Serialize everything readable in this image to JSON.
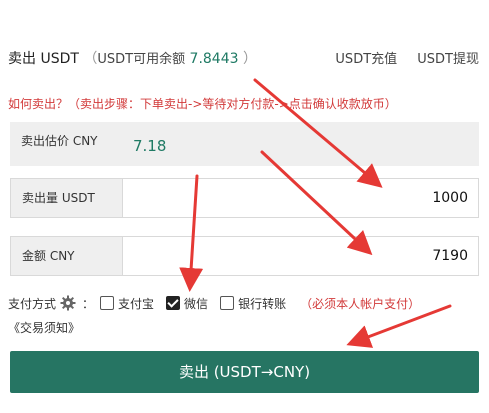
{
  "header": {
    "title": "卖出 USDT",
    "balance_label_open": "（",
    "balance_label": "USDT可用余额",
    "balance_value": "7.8443",
    "balance_label_close": "）",
    "links": [
      "USDT充值",
      "USDT提现"
    ]
  },
  "howto": "如何卖出？（卖出步骤：下单卖出->等待对方付款->点击确认收款放币）",
  "estimate": {
    "label": "卖出估价 CNY",
    "value": "7.18"
  },
  "amount": {
    "label": "卖出量 USDT",
    "value": "1000"
  },
  "total": {
    "label": "金额 CNY",
    "value": "7190"
  },
  "payment": {
    "label": "支付方式",
    "colon": "：",
    "options": [
      {
        "label": "支付宝",
        "checked": false
      },
      {
        "label": "微信",
        "checked": true
      },
      {
        "label": "银行转账",
        "checked": false
      }
    ],
    "must_note": "（必须本人帐户支付）"
  },
  "notice_link": "《交易须知》",
  "submit_label": "卖出 (USDT→CNY)",
  "colors": {
    "accent": "#267563",
    "warning": "#d23a3a",
    "arrow": "#e53935"
  }
}
